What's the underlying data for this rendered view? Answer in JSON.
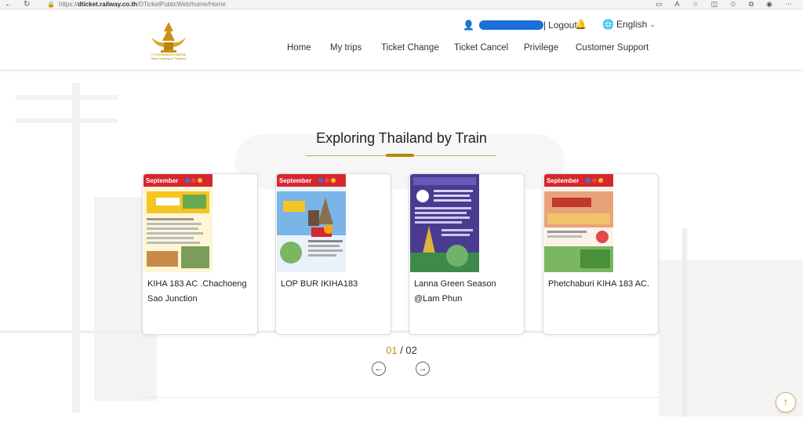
{
  "browser": {
    "url_prefix": "https://",
    "url_domain": "dticket.railway.co.th",
    "url_path": "/DTicketPublicWeb/home/Home",
    "back_icon": "arrow-left-icon",
    "refresh_icon": "refresh-icon",
    "lock_icon": "lock-icon"
  },
  "header": {
    "logout_label": "Logout",
    "language_label": "English",
    "nav": [
      "Home",
      "My trips",
      "Ticket Change",
      "Ticket Cancel",
      "Privilege",
      "Customer Support"
    ]
  },
  "section": {
    "title": "Exploring Thailand by Train"
  },
  "cards": [
    {
      "title": "KIHA 183 AC .Chachoeng Sao Junction",
      "poster_banner": "September",
      "theme": "#f5c623"
    },
    {
      "title": "LOP BUR IKIHA183",
      "poster_banner": "September",
      "theme": "#7ab5e8"
    },
    {
      "title": "Lanna Green Season @Lam Phun",
      "poster_banner": "",
      "theme": "#4b3b8f"
    },
    {
      "title": "Phetchaburi KIHA 183 AC.",
      "poster_banner": "September",
      "theme": "#e8a27a"
    }
  ],
  "pager": {
    "current": "01",
    "separator": " / ",
    "total": "02"
  },
  "colors": {
    "accent_gold": "#c9920f",
    "poster_red": "#d6262e"
  }
}
